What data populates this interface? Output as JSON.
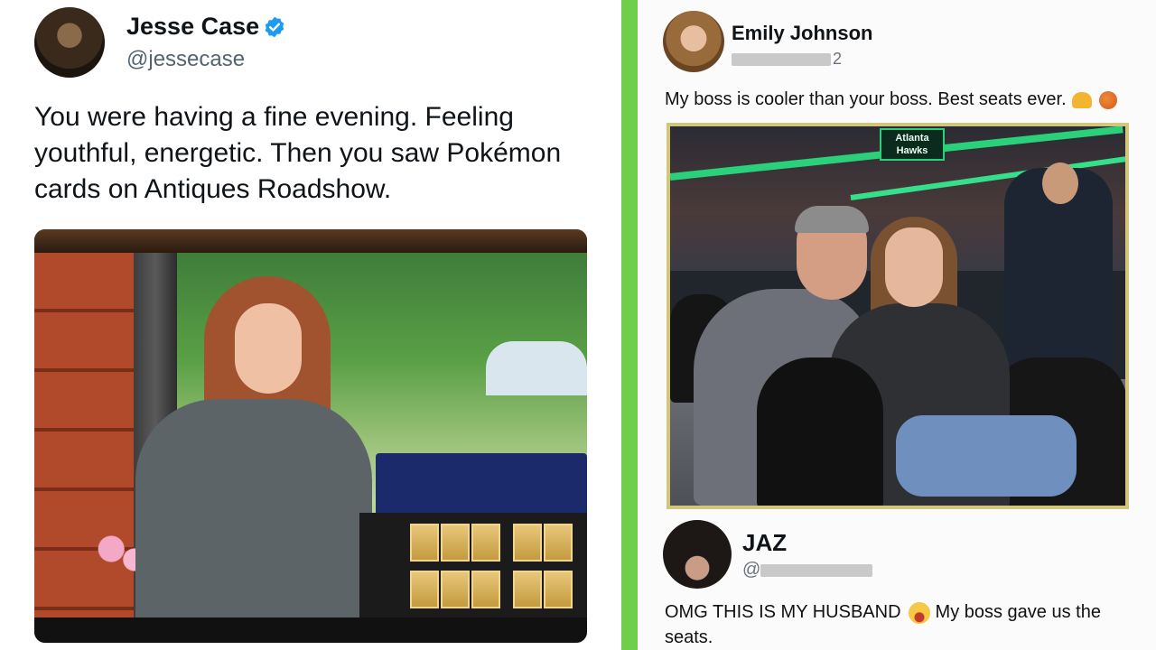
{
  "left_post": {
    "author_name": "Jesse Case",
    "author_handle": "@jessecase",
    "verified": true,
    "text": "You were having a fine evening. Feeling youthful, energetic. Then you saw Pokémon cards on Antiques Roadshow.",
    "photo_icon": "pokemon-cards-tv-photo"
  },
  "right_post": {
    "author_name": "Emily Johnson",
    "author_handle_visible_suffix": "2",
    "text": "My boss is cooler than your boss. Best seats ever.",
    "emojis": [
      "raised-hands-icon",
      "basketball-icon"
    ],
    "photo_board_text": "Atlanta Hawks",
    "photo_icon": "courtside-couple-photo"
  },
  "reply": {
    "author_name": "JAZ",
    "author_handle_prefix": "@",
    "text_before_emoji": "OMG THIS IS MY HUSBAND",
    "text_after_emoji": "My boss gave us the seats.",
    "emoji": "tears-of-joy-icon"
  },
  "colors": {
    "divider": "#6fcf4a",
    "verified": "#1d9bf0",
    "photo_border": "#d2c67a"
  }
}
